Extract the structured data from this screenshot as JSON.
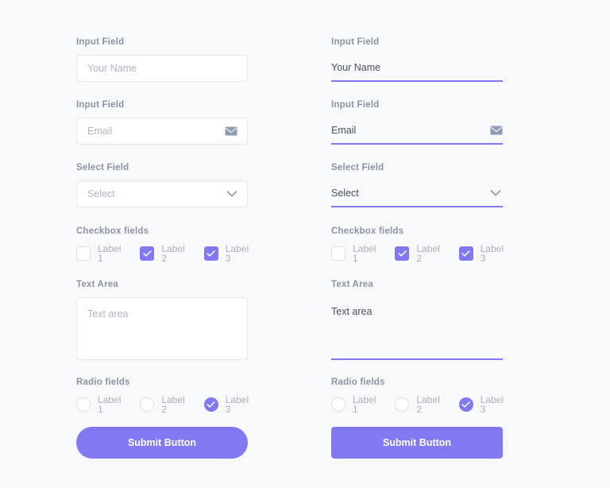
{
  "theme": {
    "accent": "#8179f2",
    "background": "#f8f9fb",
    "label_color": "#8b93a7",
    "placeholder_color": "#aeb6c4",
    "filled_text_color": "#46505f",
    "border_color": "#e4e7ed"
  },
  "columns": {
    "boxed": {
      "name_field": {
        "label": "Input Field",
        "placeholder": "Your Name",
        "value": "Your Name"
      },
      "email_field": {
        "label": "Input Field",
        "placeholder": "Email",
        "value": "Email",
        "icon": "envelope-icon"
      },
      "select_field": {
        "label": "Select Field",
        "value": "Select",
        "icon": "chevron-down-icon"
      },
      "checkbox_group": {
        "label": "Checkbox fields",
        "items": [
          {
            "label": "Label 1",
            "checked": false
          },
          {
            "label": "Label 2",
            "checked": true
          },
          {
            "label": "Label 3",
            "checked": true
          }
        ]
      },
      "textarea_field": {
        "label": "Text Area",
        "placeholder": "Text area",
        "value": "Text area"
      },
      "radio_group": {
        "label": "Radio fields",
        "items": [
          {
            "label": "Label 1",
            "selected": false
          },
          {
            "label": "Label 2",
            "selected": false
          },
          {
            "label": "Label 3",
            "selected": true
          }
        ]
      },
      "submit": {
        "label": "Submit Button"
      }
    },
    "underline": {
      "name_field": {
        "label": "Input Field",
        "placeholder": "Your Name",
        "value": "Your Name"
      },
      "email_field": {
        "label": "Input Field",
        "placeholder": "Email",
        "value": "Email",
        "icon": "envelope-icon"
      },
      "select_field": {
        "label": "Select Field",
        "value": "Select",
        "icon": "chevron-down-icon"
      },
      "checkbox_group": {
        "label": "Checkbox fields",
        "items": [
          {
            "label": "Label 1",
            "checked": false
          },
          {
            "label": "Label 2",
            "checked": true
          },
          {
            "label": "Label 3",
            "checked": true
          }
        ]
      },
      "textarea_field": {
        "label": "Text Area",
        "placeholder": "Text area",
        "value": "Text area"
      },
      "radio_group": {
        "label": "Radio fields",
        "items": [
          {
            "label": "Label 1",
            "selected": false
          },
          {
            "label": "Label 2",
            "selected": false
          },
          {
            "label": "Label 3",
            "selected": true
          }
        ]
      },
      "submit": {
        "label": "Submit Button"
      }
    }
  }
}
